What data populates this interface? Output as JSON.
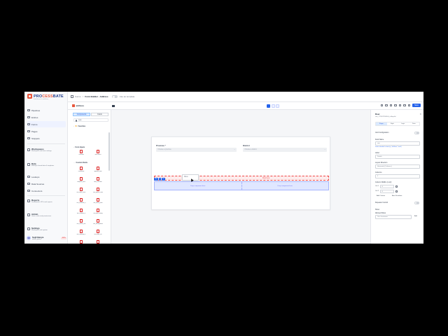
{
  "app": {
    "logo_text_a": "PRO",
    "logo_text_b": "CESS",
    "logo_text_c": "BATE",
    "logo_subtitle": "Build forms & workflows"
  },
  "nav": {
    "items": [
      {
        "label": "Pipelines"
      },
      {
        "label": "Entries"
      },
      {
        "label": "Forms"
      },
      {
        "label": "Pages"
      },
      {
        "label": "Snippets"
      }
    ],
    "cards": [
      {
        "title": "Workspaces",
        "sub": "Workspace and team settings"
      },
      {
        "title": "Data",
        "sub": "Manage shared data & templates"
      }
    ],
    "items2": [
      {
        "label": "Lookups"
      },
      {
        "label": "Data Sources"
      },
      {
        "label": "Connectors"
      }
    ],
    "cards2": [
      {
        "title": "Reports",
        "sub": "Dashboards, KPIs and exports"
      },
      {
        "title": "Admin",
        "sub": "Users, roles and permissions"
      },
      {
        "title": "Settings",
        "sub": "Workspace and system"
      }
    ],
    "user": {
      "initials": "SB",
      "name": "Sujit Banya",
      "email": "admin_system",
      "badge": "BETA"
    }
  },
  "topbar": {
    "crumbs": [
      "Forms",
      "/",
      "Form Builder - Address"
    ],
    "toggle_label": "Use as template"
  },
  "toolbar": {
    "form_name": "address",
    "save_label": "Save"
  },
  "panel": {
    "tabs": [
      "Components",
      "Fields"
    ],
    "search_value": "type",
    "sec_favorites": "Favorites",
    "sec_form_inputs": "Form Inputs",
    "sec_custom": "Custom Fields",
    "components": [
      "Checkbox",
      "Multi Select",
      "Documents",
      "approval_form",
      "complaint_form",
      "data_collection",
      "test_table_check",
      "test_product_form",
      "test_validation_a",
      "test_lookup_form",
      "test_condition_a",
      "test_date_testing",
      "test_tracker_test",
      "test_management",
      "test_inventory_a",
      "test_order_ctrl"
    ]
  },
  "canvas": {
    "province_label": "Province *",
    "province_placeholder": "Choose a province",
    "district_label": "District",
    "district_placeholder": "Choose a district",
    "drop_label": "Drop here",
    "row_tag": [
      "Row",
      "2",
      "Col"
    ],
    "tooltip_text": "Move",
    "row_cols": [
      "Drop component here",
      "Drop component here"
    ]
  },
  "props": {
    "title": "Row",
    "id": "row_1774578290564_cbfkqz4ul",
    "tabs": [
      "Props",
      "Style",
      "Logic",
      "Data"
    ],
    "sec_config": "Grid Configuration",
    "field_name_label": "Field Name",
    "field_name_value": "row",
    "field_name_help": "Used as identifier for data (e.g. 'firstName', 'email')",
    "label_label": "Label",
    "label_value": "Details",
    "layout_label": "Layout Direction",
    "layout_value": "Horizontal (Columns)",
    "columns_label": "Columns",
    "columns_value": "2",
    "widths_label": "Column Widths (1-12)",
    "col_rows": [
      {
        "label": "Col 1",
        "value": "6"
      },
      {
        "label": "Col 2",
        "value": "6"
      }
    ],
    "add_column": "Add Column",
    "auto_distribute": "Auto Distribute",
    "repeat_label": "Repeater Control",
    "show_label": "Show",
    "allowed_roles_label": "Allowed Roles",
    "allowed_roles_value": "Use shortname",
    "add_role": "Add"
  }
}
